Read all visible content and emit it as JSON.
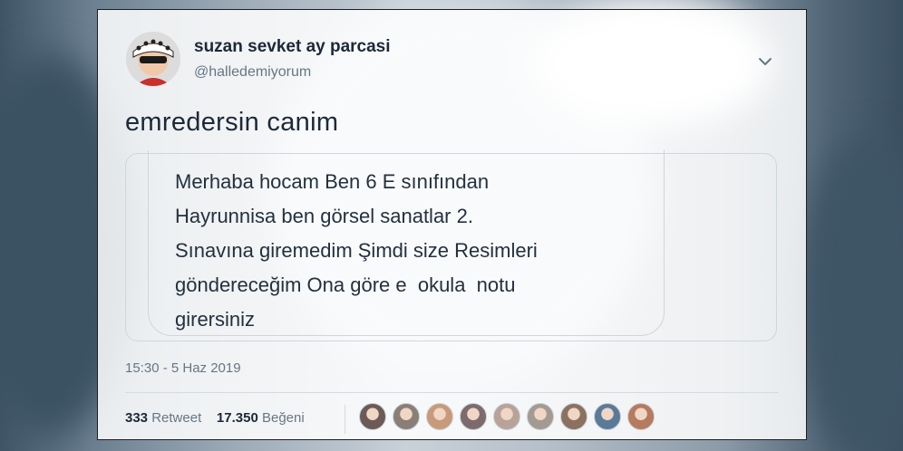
{
  "user": {
    "display_name": "suzan sevket ay parcasi",
    "handle": "@halledemiyorum"
  },
  "tweet": {
    "text": "emredersin canim",
    "timestamp": "15:30 - 5 Haz 2019"
  },
  "message_lines": [
    "Merhaba hocam Ben 6 E sınıfından",
    "Hayrunnisa ben görsel sanatlar 2.",
    "Sınavına giremedim Şimdi size Resimleri",
    "göndereceğim Ona göre e  okula  notu",
    "girersiniz"
  ],
  "stats": {
    "retweets": "333",
    "retweet_label": "Retweet",
    "likes": "17.350",
    "like_label": "Beğeni"
  },
  "liker_colors": [
    "#6b5a55",
    "#8a7f77",
    "#c99a7a",
    "#7d6a6c",
    "#b9a29a",
    "#a39a92",
    "#8c7060",
    "#5b7a9a",
    "#b67a5e"
  ],
  "icons": {
    "avatar": "avatar",
    "menu": "chevron-down-icon"
  }
}
